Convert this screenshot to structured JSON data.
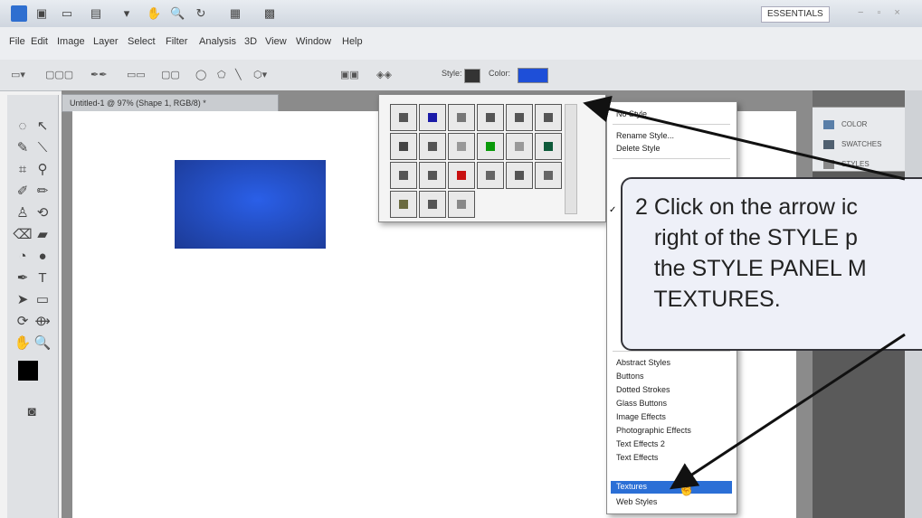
{
  "app": {
    "workspace": "ESSENTIALS",
    "menu": [
      "File",
      "Edit",
      "Image",
      "Layer",
      "Select",
      "Filter",
      "Analysis",
      "3D",
      "View",
      "Window",
      "Help"
    ]
  },
  "options_bar": {
    "style_label": "Style:",
    "color_label": "Color:",
    "color_hex": "#1e4fd8"
  },
  "document": {
    "tab_title": "Untitled-1 @ 97% (Shape 1, RGB/8) *"
  },
  "style_panel": {
    "swatch_colors": [
      "#555",
      "#1a1aa8",
      "#777",
      "#555",
      "#555",
      "#555",
      "#444",
      "#555",
      "#999",
      "#0a9a0a",
      "#999",
      "#0e5a3a",
      "#555",
      "#555",
      "#c81010",
      "#666",
      "#555",
      "#666",
      "#6a6a40",
      "#555",
      "#888"
    ]
  },
  "flyout": {
    "top_items": [
      "No Style",
      "Rename Style...",
      "Delete Style"
    ],
    "library_items": [
      "Abstract Styles",
      "Buttons",
      "Dotted Strokes",
      "Glass Buttons",
      "Image Effects",
      "Photographic Effects",
      "Text Effects 2",
      "Text Effects",
      "Textures",
      "Web Styles"
    ],
    "selected": "Textures"
  },
  "right_panels": [
    "COLOR",
    "SWATCHES",
    "STYLES"
  ],
  "callout": {
    "text": "2 Click on the arrow ic\n   right of the STYLE p\n   the STYLE PANEL M\n   TEXTURES."
  }
}
